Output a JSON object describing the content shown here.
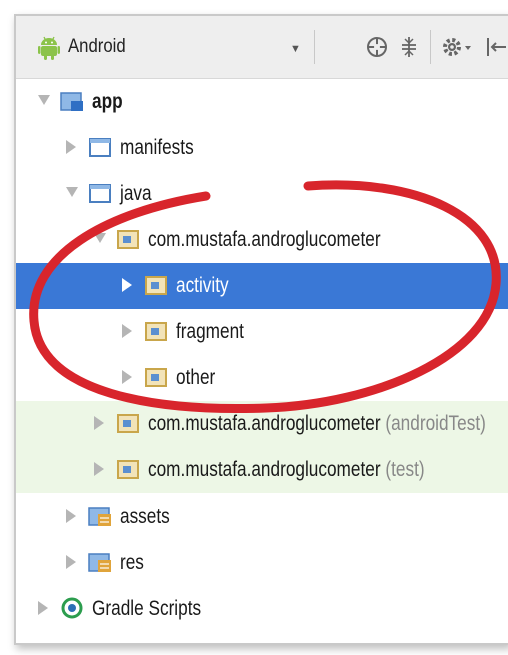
{
  "toolbar": {
    "title": "Android",
    "dropdown_arrow": "▼",
    "icons": [
      "android-icon",
      "target-icon",
      "collapse-icon",
      "gear-icon",
      "pin-icon"
    ]
  },
  "tree": [
    {
      "label": "app",
      "expanded": true,
      "icon": "module-folder-icon",
      "bold": true
    },
    {
      "label": "manifests",
      "expanded": false,
      "icon": "folder-icon"
    },
    {
      "label": "java",
      "expanded": true,
      "icon": "folder-icon"
    },
    {
      "label": "com.mustafa.androglucometer",
      "expanded": true,
      "icon": "package-icon"
    },
    {
      "label": "activity",
      "expanded": false,
      "icon": "package-icon",
      "selected": true
    },
    {
      "label": "fragment",
      "expanded": false,
      "icon": "package-icon"
    },
    {
      "label": "other",
      "expanded": false,
      "icon": "package-icon"
    },
    {
      "label": "com.mustafa.androglucometer",
      "suffix": "(androidTest)",
      "expanded": false,
      "icon": "package-icon"
    },
    {
      "label": "com.mustafa.androglucometer",
      "suffix": "(test)",
      "expanded": false,
      "icon": "package-icon"
    },
    {
      "label": "assets",
      "expanded": false,
      "icon": "resource-folder-icon"
    },
    {
      "label": "res",
      "expanded": false,
      "icon": "resource-folder-icon"
    },
    {
      "label": "Gradle Scripts",
      "expanded": false,
      "icon": "gradle-icon"
    }
  ],
  "colors": {
    "selection": "#3a78d6",
    "test_background": "#edf7e6",
    "annotation_circle": "#d8252c"
  }
}
